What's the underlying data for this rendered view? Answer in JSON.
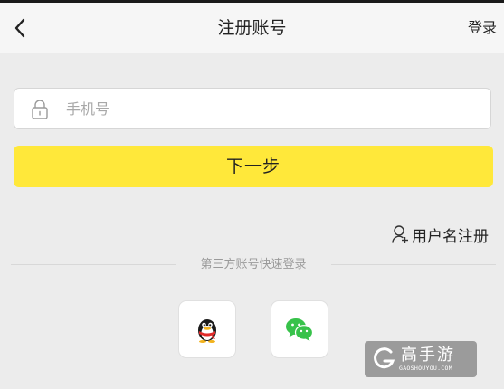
{
  "header": {
    "title": "注册账号",
    "login_label": "登录"
  },
  "phone_field": {
    "placeholder": "手机号",
    "value": ""
  },
  "next_button": {
    "label": "下一步"
  },
  "username_register": {
    "label": "用户名注册"
  },
  "third_party": {
    "title": "第三方账号快速登录",
    "providers": [
      "qq",
      "wechat"
    ]
  },
  "watermark": {
    "text": "高手游",
    "subtext": "GAOSHOUYOU.COM"
  },
  "colors": {
    "accent": "#ffe83a",
    "wechat": "#37c24a",
    "qq_scarf": "#e02a2a"
  }
}
